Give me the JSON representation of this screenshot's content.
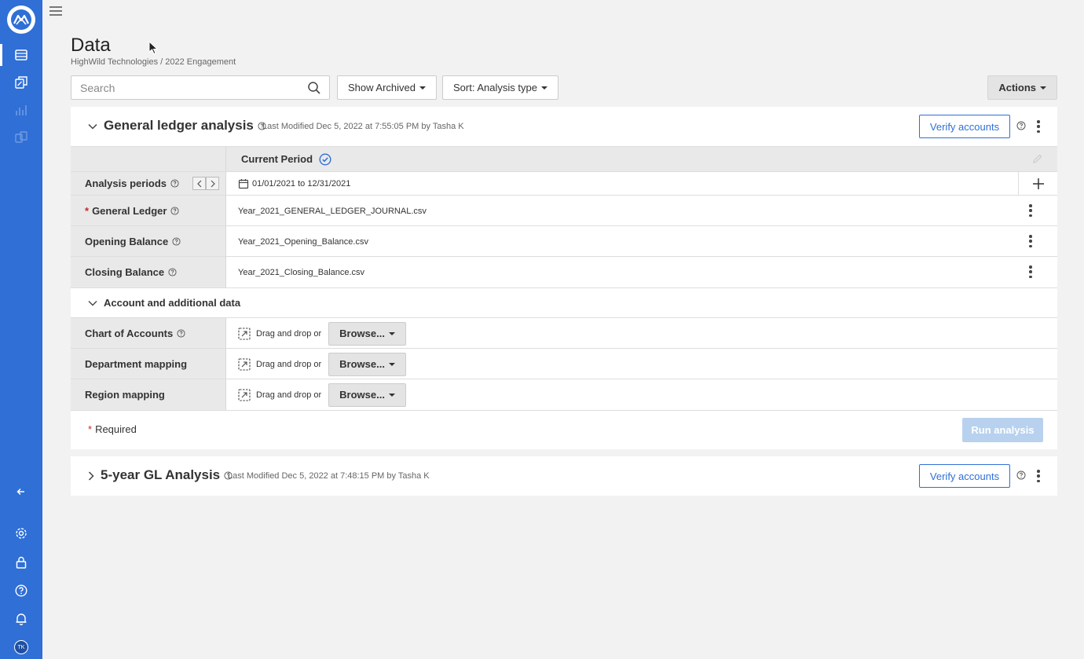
{
  "sidebar": {
    "avatar_initials": "TK",
    "icons": [
      "logo-icon",
      "database-icon",
      "documents-icon",
      "chart-icon",
      "transfer-icon",
      "collapse-icon",
      "gear-icon",
      "lock-icon",
      "help-icon",
      "bell-icon"
    ]
  },
  "page": {
    "title": "Data",
    "breadcrumb": "HighWild Technologies / 2022 Engagement"
  },
  "toolbar": {
    "search_placeholder": "Search",
    "show_archived": "Show Archived",
    "sort": "Sort: Analysis type",
    "actions": "Actions"
  },
  "card1": {
    "title": "General ledger analysis",
    "modified": "Last Modified Dec 5, 2022 at 7:55:05 PM by Tasha K",
    "verify": "Verify accounts",
    "period_header": "Current Period",
    "rows": {
      "analysis_periods": {
        "label": "Analysis periods",
        "value": "01/01/2021 to 12/31/2021"
      },
      "general_ledger": {
        "required": "*",
        "label": "General Ledger",
        "value": "Year_2021_GENERAL_LEDGER_JOURNAL.csv"
      },
      "opening_balance": {
        "label": "Opening Balance",
        "value": "Year_2021_Opening_Balance.csv"
      },
      "closing_balance": {
        "label": "Closing Balance",
        "value": "Year_2021_Closing_Balance.csv"
      }
    },
    "section_title": "Account and additional data",
    "uploads": [
      {
        "label": "Chart of Accounts",
        "drop": "Drag and drop or",
        "browse": "Browse..."
      },
      {
        "label": "Department mapping",
        "drop": "Drag and drop or",
        "browse": "Browse..."
      },
      {
        "label": "Region mapping",
        "drop": "Drag and drop or",
        "browse": "Browse..."
      }
    ],
    "required_mark": "*",
    "required_note": "Required",
    "run": "Run analysis"
  },
  "card2": {
    "title": "5-year GL Analysis",
    "modified": "Last Modified Dec 5, 2022 at 7:48:15 PM by Tasha K",
    "verify": "Verify accounts"
  },
  "colors": {
    "sidebar": "#2f6fd6",
    "accent": "#2f6fd6",
    "required": "#c62828",
    "run_disabled": "#b8d1ee"
  }
}
